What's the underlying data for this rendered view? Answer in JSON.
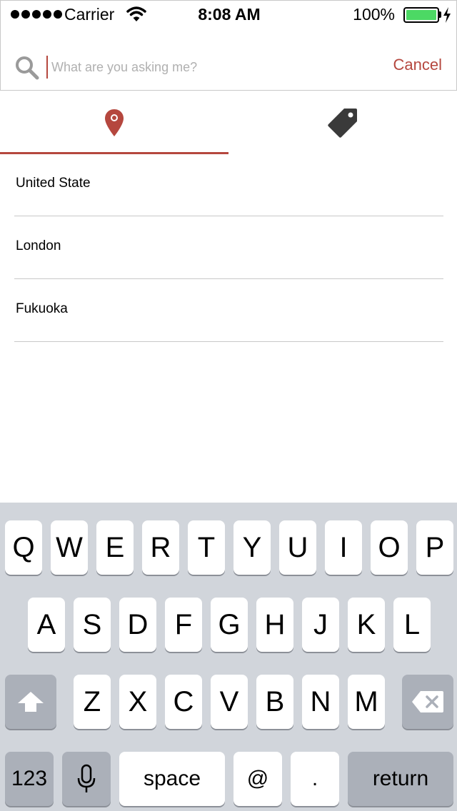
{
  "status_bar": {
    "carrier": "Carrier",
    "time": "8:08 AM",
    "battery": "100%",
    "battery_level": 1.0,
    "battery_color": "#4cd964"
  },
  "search": {
    "placeholder": "What are you asking me?",
    "value": "",
    "cancel_label": "Cancel",
    "accent_color": "#b5473e"
  },
  "tabs": [
    {
      "icon": "location-pin-icon",
      "selected": true
    },
    {
      "icon": "tag-icon",
      "selected": false
    }
  ],
  "results": [
    {
      "label": "United State"
    },
    {
      "label": "London"
    },
    {
      "label": "Fukuoka"
    }
  ],
  "keyboard": {
    "row1": [
      "Q",
      "W",
      "E",
      "R",
      "T",
      "Y",
      "U",
      "I",
      "O",
      "P"
    ],
    "row2": [
      "A",
      "S",
      "D",
      "F",
      "G",
      "H",
      "J",
      "K",
      "L"
    ],
    "row3": [
      "Z",
      "X",
      "C",
      "V",
      "B",
      "N",
      "M"
    ],
    "numbers_label": "123",
    "space_label": "space",
    "at_label": "@",
    "period_label": ".",
    "return_label": "return"
  }
}
